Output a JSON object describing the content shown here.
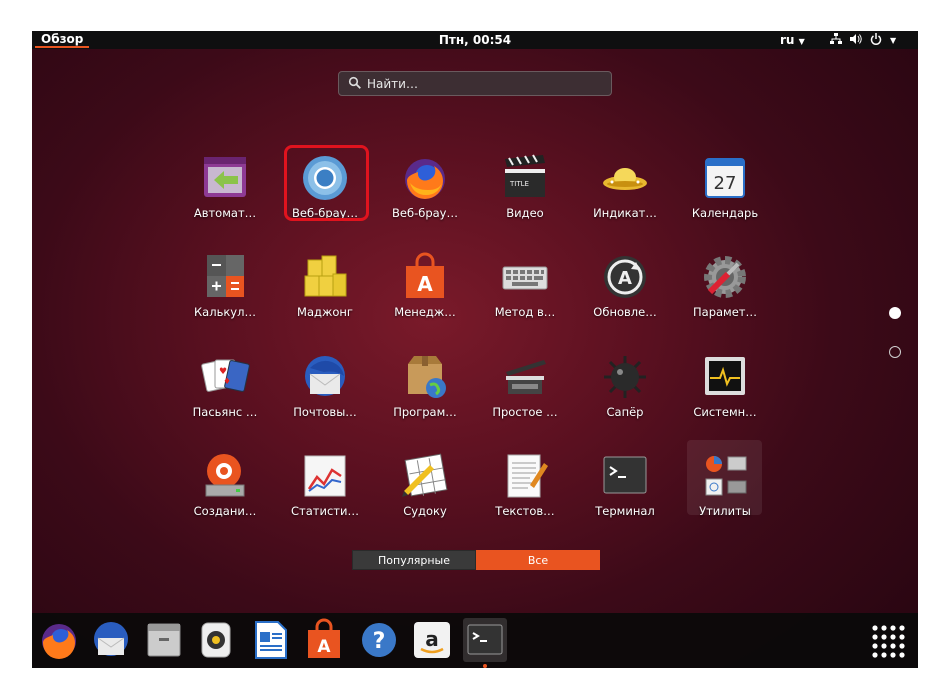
{
  "topbar": {
    "overview": "Обзор",
    "clock": "Птн, 00:54",
    "language": "ru"
  },
  "search": {
    "placeholder": "Найти…"
  },
  "apps": [
    {
      "label": "Автомат…",
      "icon": "automation-icon"
    },
    {
      "label": "Веб-брау…",
      "icon": "chromium-icon"
    },
    {
      "label": "Веб-брау…",
      "icon": "firefox-icon"
    },
    {
      "label": "Видео",
      "icon": "video-clapper-icon"
    },
    {
      "label": "Индикат…",
      "icon": "ufo-indicator-icon"
    },
    {
      "label": "Календарь",
      "icon": "calendar-icon",
      "day": "27"
    },
    {
      "label": "Калькул…",
      "icon": "calculator-icon"
    },
    {
      "label": "Маджонг",
      "icon": "mahjong-icon"
    },
    {
      "label": "Менедж…",
      "icon": "software-manager-icon"
    },
    {
      "label": "Метод в…",
      "icon": "keyboard-icon"
    },
    {
      "label": "Обновле…",
      "icon": "software-updater-icon"
    },
    {
      "label": "Парамет…",
      "icon": "settings-gear-icon"
    },
    {
      "label": "Пасьянс …",
      "icon": "solitaire-cards-icon"
    },
    {
      "label": "Почтовы…",
      "icon": "thunderbird-mail-icon"
    },
    {
      "label": "Програм…",
      "icon": "software-package-icon"
    },
    {
      "label": "Простое …",
      "icon": "scanner-icon"
    },
    {
      "label": "Сапёр",
      "icon": "mines-icon"
    },
    {
      "label": "Системн…",
      "icon": "system-monitor-icon"
    },
    {
      "label": "Создани…",
      "icon": "startup-disk-icon"
    },
    {
      "label": "Статисти…",
      "icon": "statistics-chart-icon"
    },
    {
      "label": "Судоку",
      "icon": "sudoku-icon"
    },
    {
      "label": "Текстов…",
      "icon": "text-editor-icon"
    },
    {
      "label": "Терминал",
      "icon": "terminal-icon"
    },
    {
      "label": "Утилиты",
      "icon": "utilities-folder-icon"
    }
  ],
  "tabs": {
    "popular": "Популярные",
    "all": "Все",
    "active": "all"
  },
  "pages": {
    "current": 1,
    "total": 2
  },
  "dock": [
    "firefox-icon",
    "thunderbird-mail-icon",
    "files-icon",
    "rhythmbox-icon",
    "libreoffice-writer-icon",
    "software-manager-icon",
    "help-icon",
    "amazon-icon",
    "terminal-icon"
  ],
  "colors": {
    "accent": "#e95420",
    "highlight": "#e0131e",
    "topbar": "#0f0f10"
  }
}
